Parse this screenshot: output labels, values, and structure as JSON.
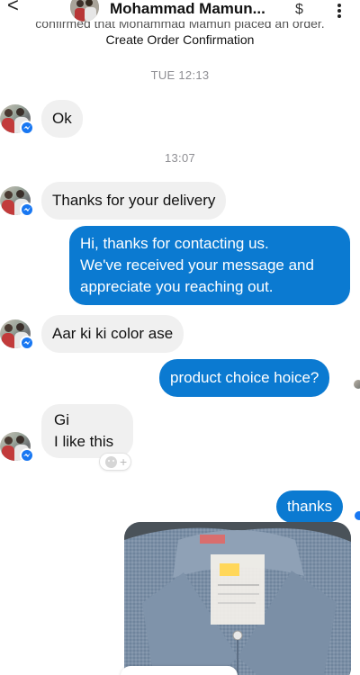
{
  "header": {
    "contact_name": "Mohammad Mamun...",
    "dollar_symbol": "$",
    "back_glyph": "<"
  },
  "system": {
    "clipped_notice": "confirmed that Mohammad Mamun placed an order.",
    "link": "Create Order Confirmation"
  },
  "timestamps": {
    "first": "TUE 12:13",
    "second": "13:07"
  },
  "messages": [
    {
      "from": "contact",
      "text": "Ok"
    },
    {
      "from": "contact",
      "text": "Thanks for your delivery"
    },
    {
      "from": "me",
      "lines": [
        "Hi, thanks for contacting us.",
        "We've received your message and",
        "appreciate you reaching out."
      ]
    },
    {
      "from": "contact",
      "text": "Aar ki ki color ase"
    },
    {
      "from": "me",
      "text": "product choice hoice?"
    },
    {
      "from": "contact",
      "lines": [
        "Gi",
        "I like this"
      ]
    },
    {
      "from": "me",
      "text": "thanks"
    },
    {
      "from": "me",
      "type": "image",
      "image_description_icon": "shirt-photo"
    }
  ],
  "reaction": {
    "icon": "add-reaction-icon",
    "plus": "+"
  },
  "colors": {
    "outgoing_bubble": "#0b7ad1",
    "incoming_bubble": "#f0f0f0",
    "messenger_badge": "#1877f2"
  }
}
